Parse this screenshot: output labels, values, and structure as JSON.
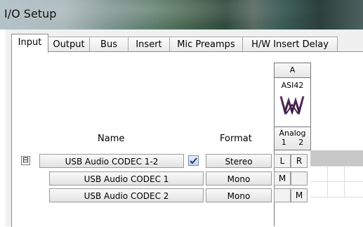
{
  "window": {
    "title": "I/O Setup"
  },
  "tabs": [
    {
      "label": "Input",
      "active": true
    },
    {
      "label": "Output",
      "active": false
    },
    {
      "label": "Bus",
      "active": false
    },
    {
      "label": "Insert",
      "active": false
    },
    {
      "label": "Mic Preamps",
      "active": false
    },
    {
      "label": "H/W Insert Delay",
      "active": false
    }
  ],
  "headers": {
    "name": "Name",
    "format": "Format"
  },
  "grid_header": {
    "group": "A",
    "device": "ASI42",
    "type": "Analog",
    "ch1": "1",
    "ch2": "2"
  },
  "collapse_symbol": "⊟",
  "rows": [
    {
      "name": "USB Audio CODEC 1-2",
      "format": "Stereo",
      "checked": true,
      "ch1": "L",
      "ch2": "R"
    },
    {
      "name": "USB Audio CODEC 1",
      "format": "Mono",
      "ch1": "M",
      "ch2": ""
    },
    {
      "name": "USB Audio CODEC 2",
      "format": "Mono",
      "ch1": "",
      "ch2": "M"
    }
  ]
}
